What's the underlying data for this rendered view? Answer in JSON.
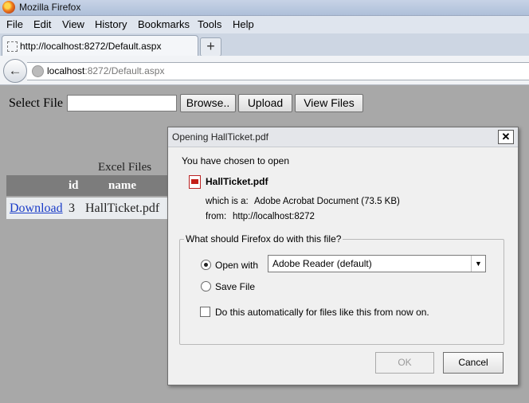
{
  "window": {
    "title": "Mozilla Firefox"
  },
  "menu": {
    "items": [
      {
        "label": "File"
      },
      {
        "label": "Edit"
      },
      {
        "label": "View"
      },
      {
        "label": "History"
      },
      {
        "label": "Bookmarks"
      },
      {
        "label": "Tools"
      },
      {
        "label": "Help"
      }
    ]
  },
  "tab": {
    "title": "http://localhost:8272/Default.aspx",
    "new_tab_symbol": "+"
  },
  "nav": {
    "back_symbol": "←",
    "url_host": "localhost",
    "url_rest": ":8272/Default.aspx"
  },
  "page": {
    "select_label": "Select File",
    "file_input_value": "",
    "browse_label": "Browse..",
    "upload_label": "Upload",
    "view_files_label": "View Files",
    "table_caption": "Excel Files",
    "columns": [
      "",
      "id",
      "name"
    ],
    "rows": [
      {
        "action": "Download",
        "id": "3",
        "name": "HallTicket.pdf"
      }
    ]
  },
  "dialog": {
    "title": "Opening HallTicket.pdf",
    "close_symbol": "✕",
    "chosen_text": "You have chosen to open",
    "filename": "HallTicket.pdf",
    "which_is_label": "which is a:",
    "which_is_value": "Adobe Acrobat Document (73.5 KB)",
    "from_label": "from:",
    "from_value": "http://localhost:8272",
    "group_label": "What should Firefox do with this file?",
    "open_with_label": "Open with",
    "open_with_app": "Adobe Reader  (default)",
    "open_with_selected": true,
    "save_file_label": "Save File",
    "auto_label": "Do this automatically for files like this from now on.",
    "auto_checked": false,
    "ok_label": "OK",
    "cancel_label": "Cancel"
  }
}
